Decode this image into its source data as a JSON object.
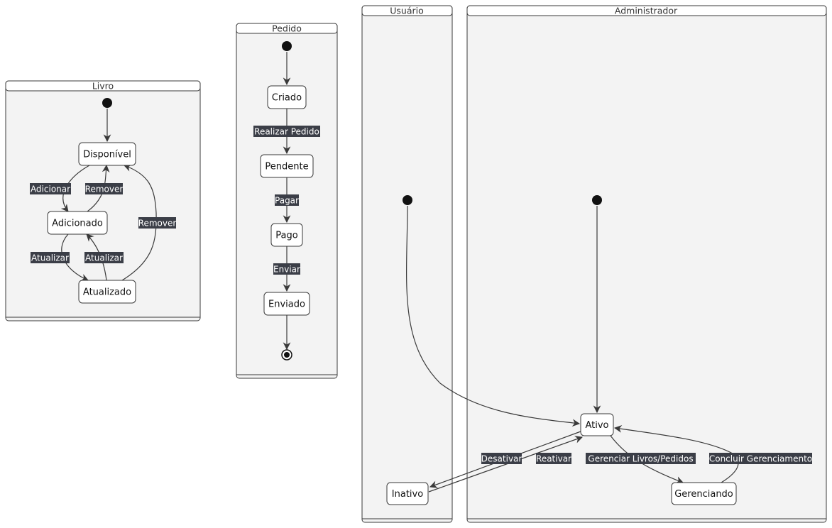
{
  "diagram": {
    "clusters": {
      "livro": "Livro",
      "pedido": "Pedido",
      "usuario": "Usuário",
      "administrador": "Administrador"
    },
    "states": {
      "disponivel": "Disponível",
      "adicionado": "Adicionado",
      "atualizado": "Atualizado",
      "criado": "Criado",
      "pendente": "Pendente",
      "pago": "Pago",
      "enviado": "Enviado",
      "ativo": "Ativo",
      "inativo": "Inativo",
      "gerenciando": "Gerenciando"
    },
    "transitions": {
      "adicionar": "Adicionar",
      "remover_1": "Remover",
      "atualizar_1": "Atualizar",
      "atualizar_2": "Atualizar",
      "remover_2": "Remover",
      "realizar_pedido": "Realizar Pedido",
      "pagar": "Pagar",
      "enviar": "Enviar",
      "desativar": "Desativar",
      "reativar": "Reativar",
      "gerenciar": "Gerenciar Livros/Pedidos",
      "concluir": "Concluir Gerenciamento"
    }
  }
}
